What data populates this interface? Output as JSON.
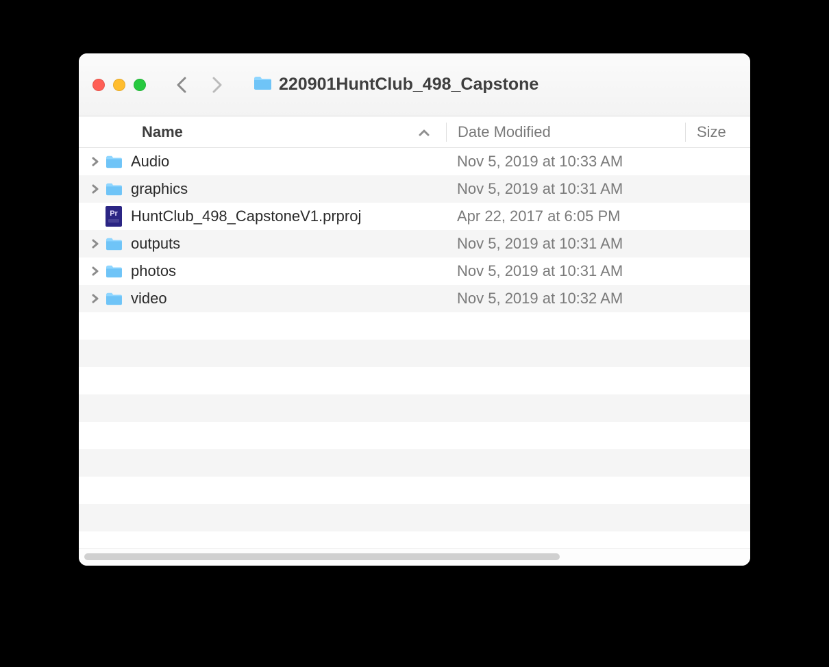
{
  "window": {
    "title": "220901HuntClub_498_Capstone"
  },
  "columns": {
    "name": "Name",
    "date": "Date Modified",
    "size": "Size",
    "sorted_by": "name",
    "sort_direction": "asc"
  },
  "items": [
    {
      "type": "folder",
      "name": "Audio",
      "date": "Nov 5, 2019 at 10:33 AM",
      "size": "",
      "expandable": true
    },
    {
      "type": "folder",
      "name": "graphics",
      "date": "Nov 5, 2019 at 10:31 AM",
      "size": "",
      "expandable": true
    },
    {
      "type": "file",
      "name": "HuntClub_498_CapstoneV1.prproj",
      "date": "Apr 22, 2017 at 6:05 PM",
      "size": "",
      "expandable": false,
      "file_kind": "premiere-project"
    },
    {
      "type": "folder",
      "name": "outputs",
      "date": "Nov 5, 2019 at 10:31 AM",
      "size": "",
      "expandable": true
    },
    {
      "type": "folder",
      "name": "photos",
      "date": "Nov 5, 2019 at 10:31 AM",
      "size": "",
      "expandable": true
    },
    {
      "type": "folder",
      "name": "video",
      "date": "Nov 5, 2019 at 10:32 AM",
      "size": "",
      "expandable": true
    }
  ]
}
